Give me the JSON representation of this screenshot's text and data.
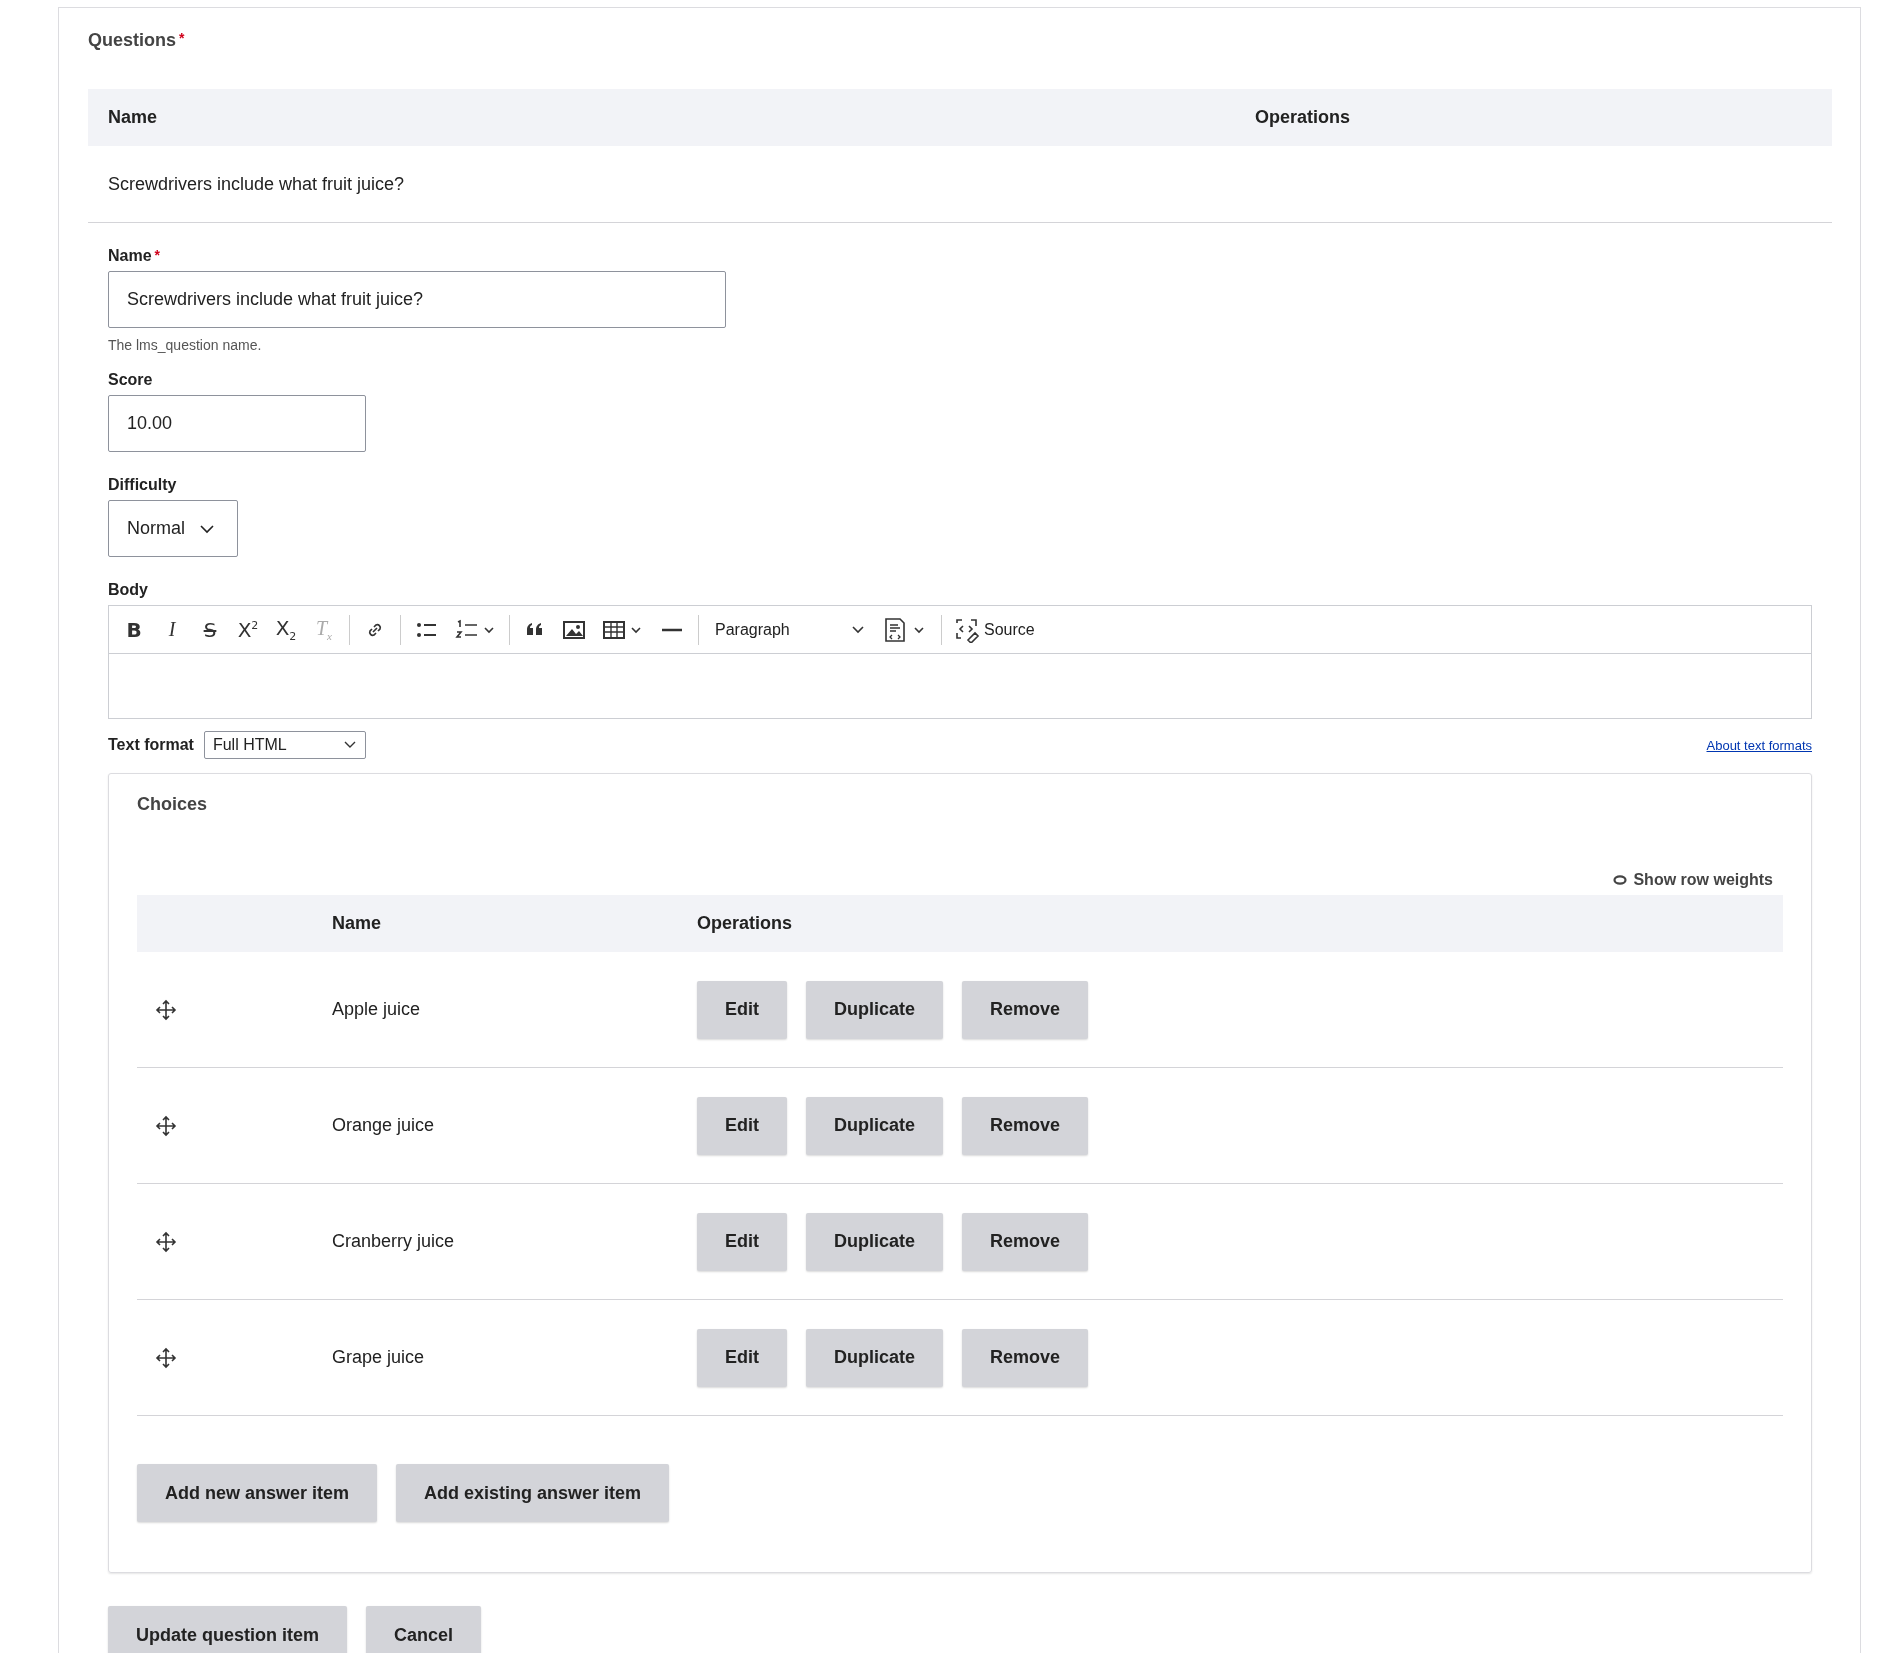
{
  "questions": {
    "label": "Questions",
    "required_mark": "*",
    "table": {
      "columns": [
        "Name",
        "Operations"
      ],
      "rows": [
        {
          "name": "Screwdrivers include what fruit juice?"
        }
      ]
    }
  },
  "form": {
    "name": {
      "label": "Name",
      "required_mark": "*",
      "value": "Screwdrivers include what fruit juice?",
      "hint": "The lms_question name."
    },
    "score": {
      "label": "Score",
      "value": "10.00"
    },
    "difficulty": {
      "label": "Difficulty",
      "value": "Normal"
    },
    "body": {
      "label": "Body",
      "toolbar": {
        "format_buttons": [
          {
            "kind": "bold",
            "label": "B"
          },
          {
            "kind": "italic",
            "label": "I"
          },
          {
            "kind": "strike",
            "label": "S"
          },
          {
            "kind": "superscript",
            "label": "X$^{2}$"
          },
          {
            "kind": "subscript",
            "label": "X$_{2}$"
          },
          {
            "kind": "clear",
            "label": "T$_{x}$"
          }
        ],
        "heading_select": "Paragraph",
        "source_button": "Source"
      }
    },
    "text_format": {
      "label": "Text format",
      "value": "Full HTML",
      "help_link": "About text formats"
    }
  },
  "choices": {
    "title": "Choices",
    "show_weights": "Show row weights",
    "columns": [
      "Name",
      "Operations"
    ],
    "rows": [
      {
        "name": "Apple juice",
        "actions": [
          "Edit",
          "Duplicate",
          "Remove"
        ]
      },
      {
        "name": "Orange juice",
        "actions": [
          "Edit",
          "Duplicate",
          "Remove"
        ]
      },
      {
        "name": "Cranberry juice",
        "actions": [
          "Edit",
          "Duplicate",
          "Remove"
        ]
      },
      {
        "name": "Grape juice",
        "actions": [
          "Edit",
          "Duplicate",
          "Remove"
        ]
      }
    ],
    "buttons": [
      "Add new answer item",
      "Add existing answer item"
    ]
  },
  "actions": [
    "Update question item",
    "Cancel"
  ]
}
